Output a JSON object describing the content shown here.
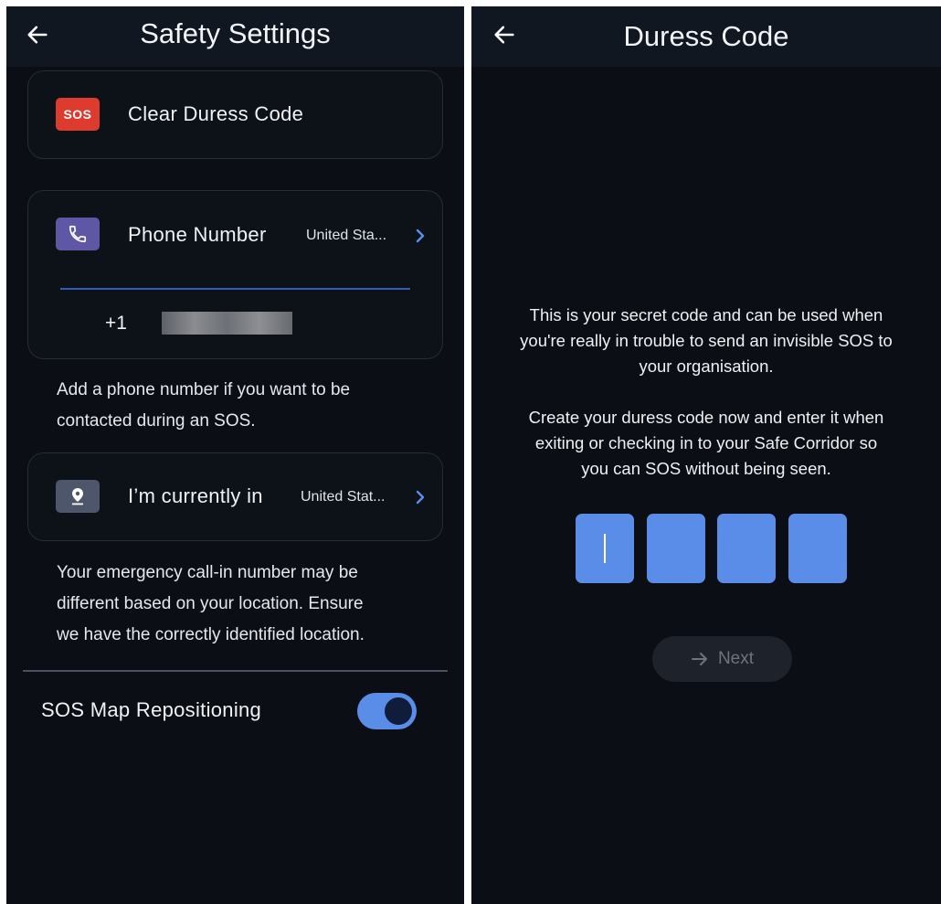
{
  "left": {
    "title": "Safety Settings",
    "duress": {
      "label": "Clear Duress Code",
      "icon": "sos-icon",
      "icon_text": "SOS"
    },
    "phone": {
      "label": "Phone Number",
      "country": "United Sta...",
      "prefix": "+1",
      "icon": "phone-icon"
    },
    "phone_help": [
      "Add a phone number if you want to be",
      "contacted during an SOS."
    ],
    "location": {
      "label": "I’m currently in",
      "country": "United Stat...",
      "icon": "location-pin-icon"
    },
    "location_help": [
      "Your emergency call-in number may be",
      "different based on your location. Ensure",
      "we have the correctly identified location."
    ],
    "toggle": {
      "label": "SOS Map Repositioning",
      "on": true
    }
  },
  "right": {
    "title": "Duress Code",
    "paragraph1": [
      "This is your secret code and can be used when",
      "you're really in trouble to send an invisible SOS to",
      "your organisation."
    ],
    "paragraph2": [
      "Create your duress code now and enter it when",
      "exiting or checking in to your Safe Corridor so",
      "you can SOS without being seen."
    ],
    "code_digits": 4,
    "next_label": "Next"
  },
  "colors": {
    "background": "#0b0e14",
    "appbar": "#111720",
    "sos_red": "#de3b2f",
    "phone_purple": "#5e57a6",
    "location_gray": "#4d566a",
    "accent_blue": "#5a8de8",
    "chevron_blue": "#5b8ef0"
  }
}
